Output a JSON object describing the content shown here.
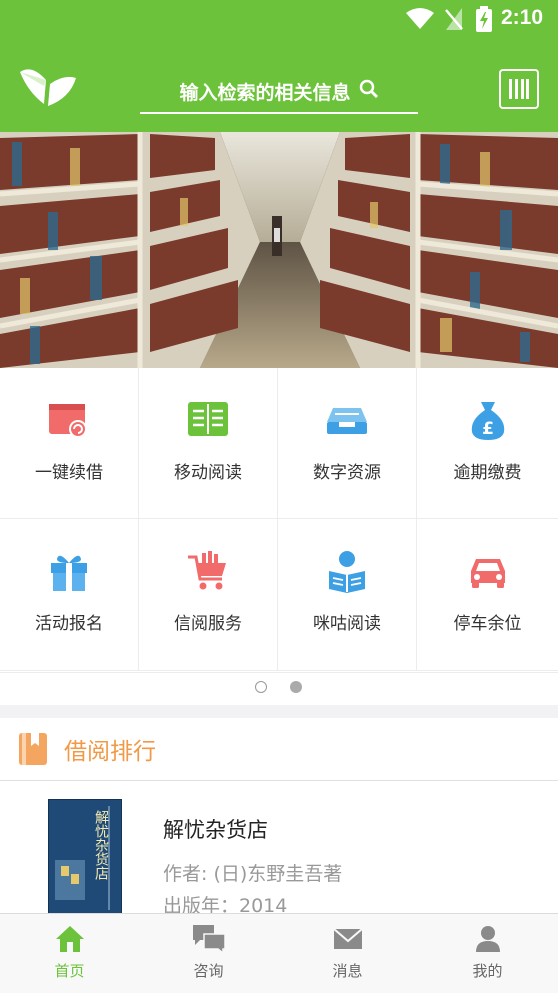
{
  "status_bar": {
    "time": "2:10"
  },
  "header": {
    "search_placeholder": "输入检索的相关信息"
  },
  "grid": {
    "items": [
      {
        "label": "一键续借",
        "icon": "book-renew-icon",
        "color": "#f26b6b"
      },
      {
        "label": "移动阅读",
        "icon": "open-book-icon",
        "color": "#6cc23a"
      },
      {
        "label": "数字资源",
        "icon": "inbox-tray-icon",
        "color": "#3ea0e4"
      },
      {
        "label": "逾期缴费",
        "icon": "money-bag-icon",
        "color": "#3ea0e4"
      },
      {
        "label": "活动报名",
        "icon": "gift-icon",
        "color": "#3ea0e4"
      },
      {
        "label": "信阅服务",
        "icon": "shopping-cart-icon",
        "color": "#f26b6b"
      },
      {
        "label": "咪咕阅读",
        "icon": "reader-person-icon",
        "color": "#3ea0e4"
      },
      {
        "label": "停车余位",
        "icon": "car-icon",
        "color": "#f26b6b"
      }
    ]
  },
  "ranking": {
    "title": "借阅排行",
    "books": [
      {
        "title": "解忧杂货店",
        "author": "作者: (日)东野圭吾著",
        "year": "出版年：2014",
        "cover_text": "解忧杂货店"
      }
    ]
  },
  "tabbar": {
    "tabs": [
      {
        "label": "首页",
        "icon": "home-icon"
      },
      {
        "label": "咨询",
        "icon": "chat-bubbles-icon"
      },
      {
        "label": "消息",
        "icon": "mail-icon"
      },
      {
        "label": "我的",
        "icon": "person-icon"
      }
    ]
  },
  "colors": {
    "brand": "#6cc23a",
    "accent": "#f09a48"
  }
}
